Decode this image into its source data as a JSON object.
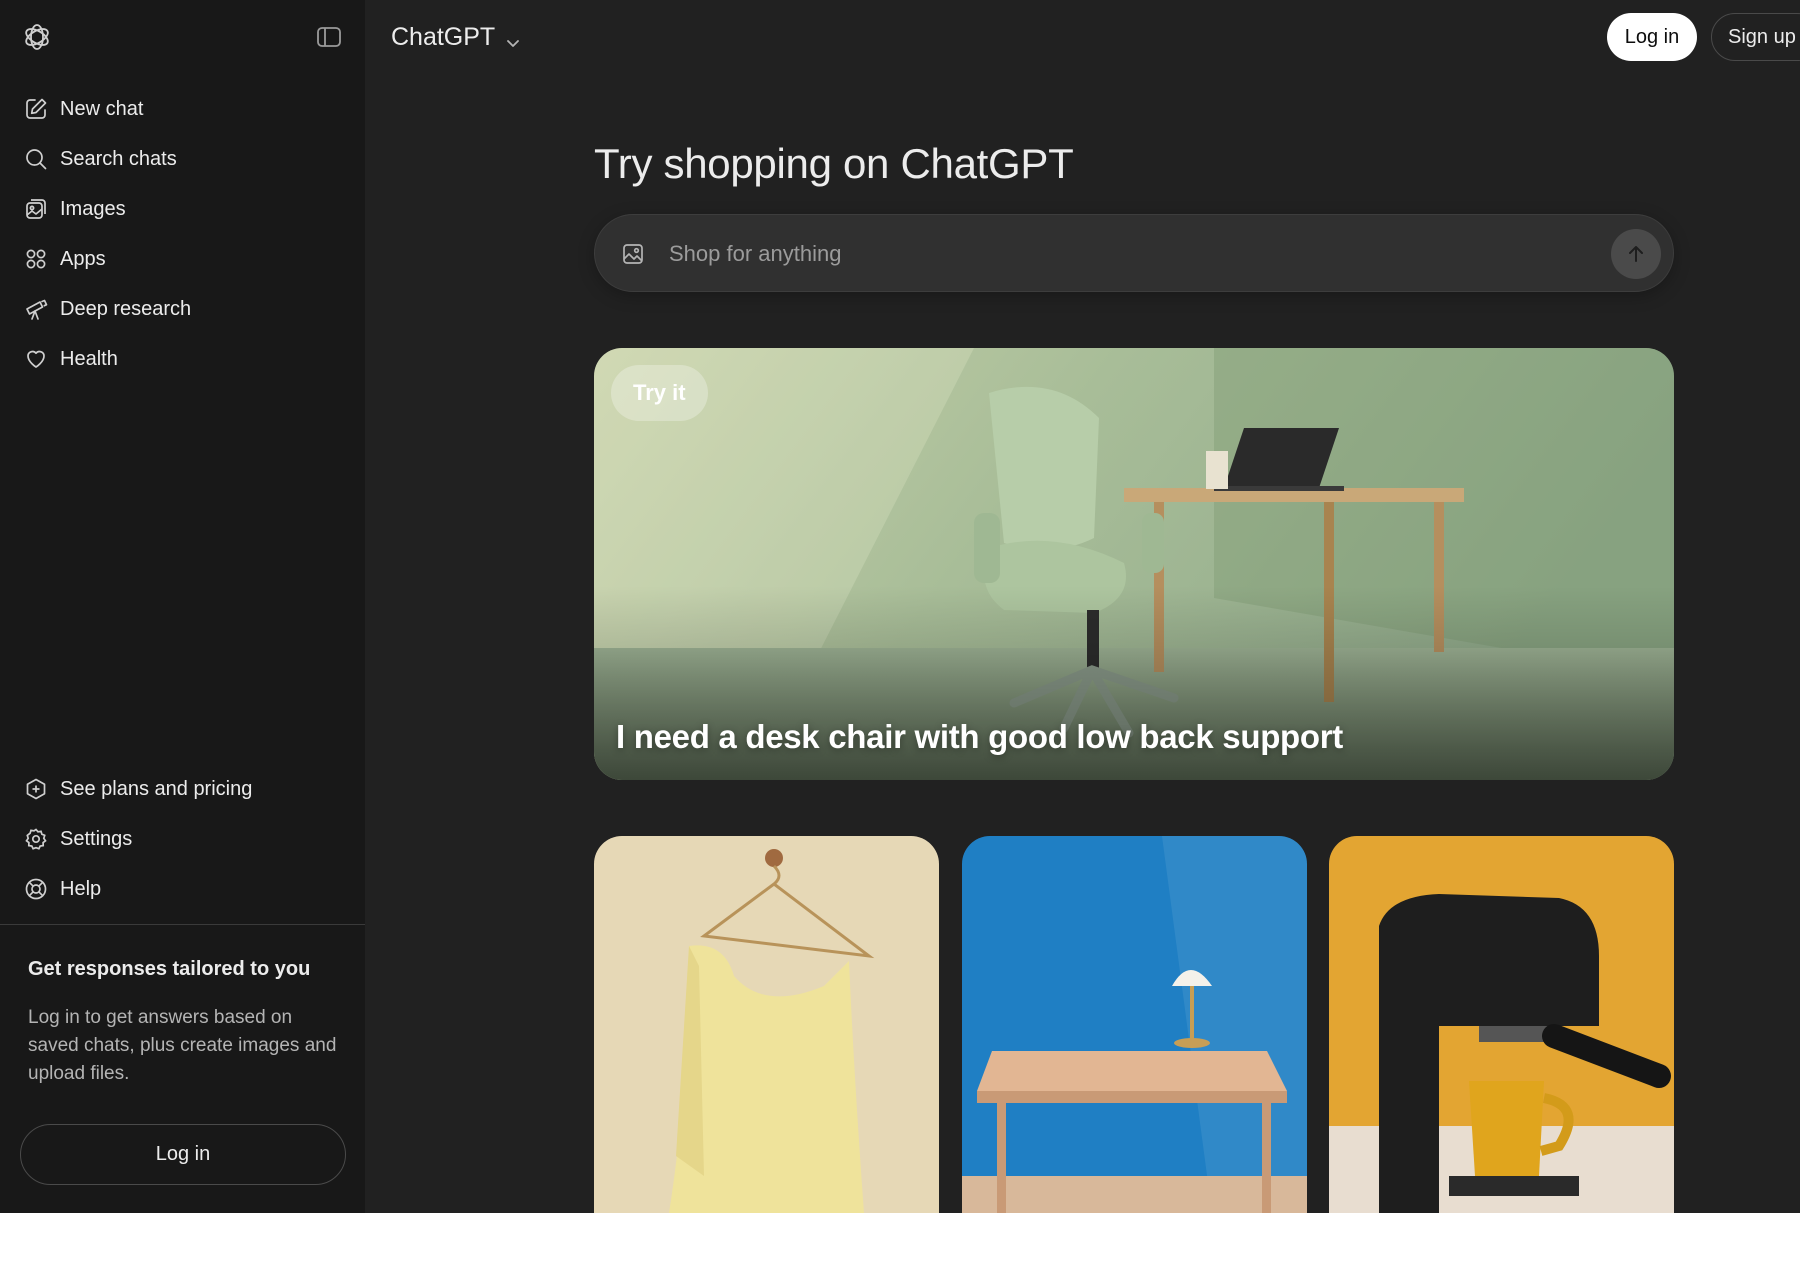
{
  "header": {
    "model_name": "ChatGPT",
    "login_label": "Log in",
    "signup_label": "Sign up"
  },
  "sidebar": {
    "top_items": [
      {
        "label": "New chat",
        "icon": "edit-icon"
      },
      {
        "label": "Search chats",
        "icon": "search-icon"
      },
      {
        "label": "Images",
        "icon": "images-icon"
      },
      {
        "label": "Apps",
        "icon": "apps-icon"
      },
      {
        "label": "Deep research",
        "icon": "telescope-icon"
      },
      {
        "label": "Health",
        "icon": "heart-icon"
      }
    ],
    "bottom_items": [
      {
        "label": "See plans and pricing",
        "icon": "plans-icon"
      },
      {
        "label": "Settings",
        "icon": "gear-icon"
      },
      {
        "label": "Help",
        "icon": "help-icon"
      }
    ],
    "promo": {
      "title": "Get responses tailored to you",
      "text": "Log in to get answers based on saved chats, plus create images and upload files."
    },
    "login_label": "Log in"
  },
  "main": {
    "title": "Try shopping on ChatGPT",
    "search": {
      "placeholder": "Shop for anything"
    },
    "hero": {
      "badge": "Try it",
      "caption": "I need a desk chair with good low back support"
    }
  },
  "colors": {
    "app_bg": "#212121",
    "sidebar_bg": "#181818",
    "input_bg": "#303030",
    "text": "#ececec"
  }
}
